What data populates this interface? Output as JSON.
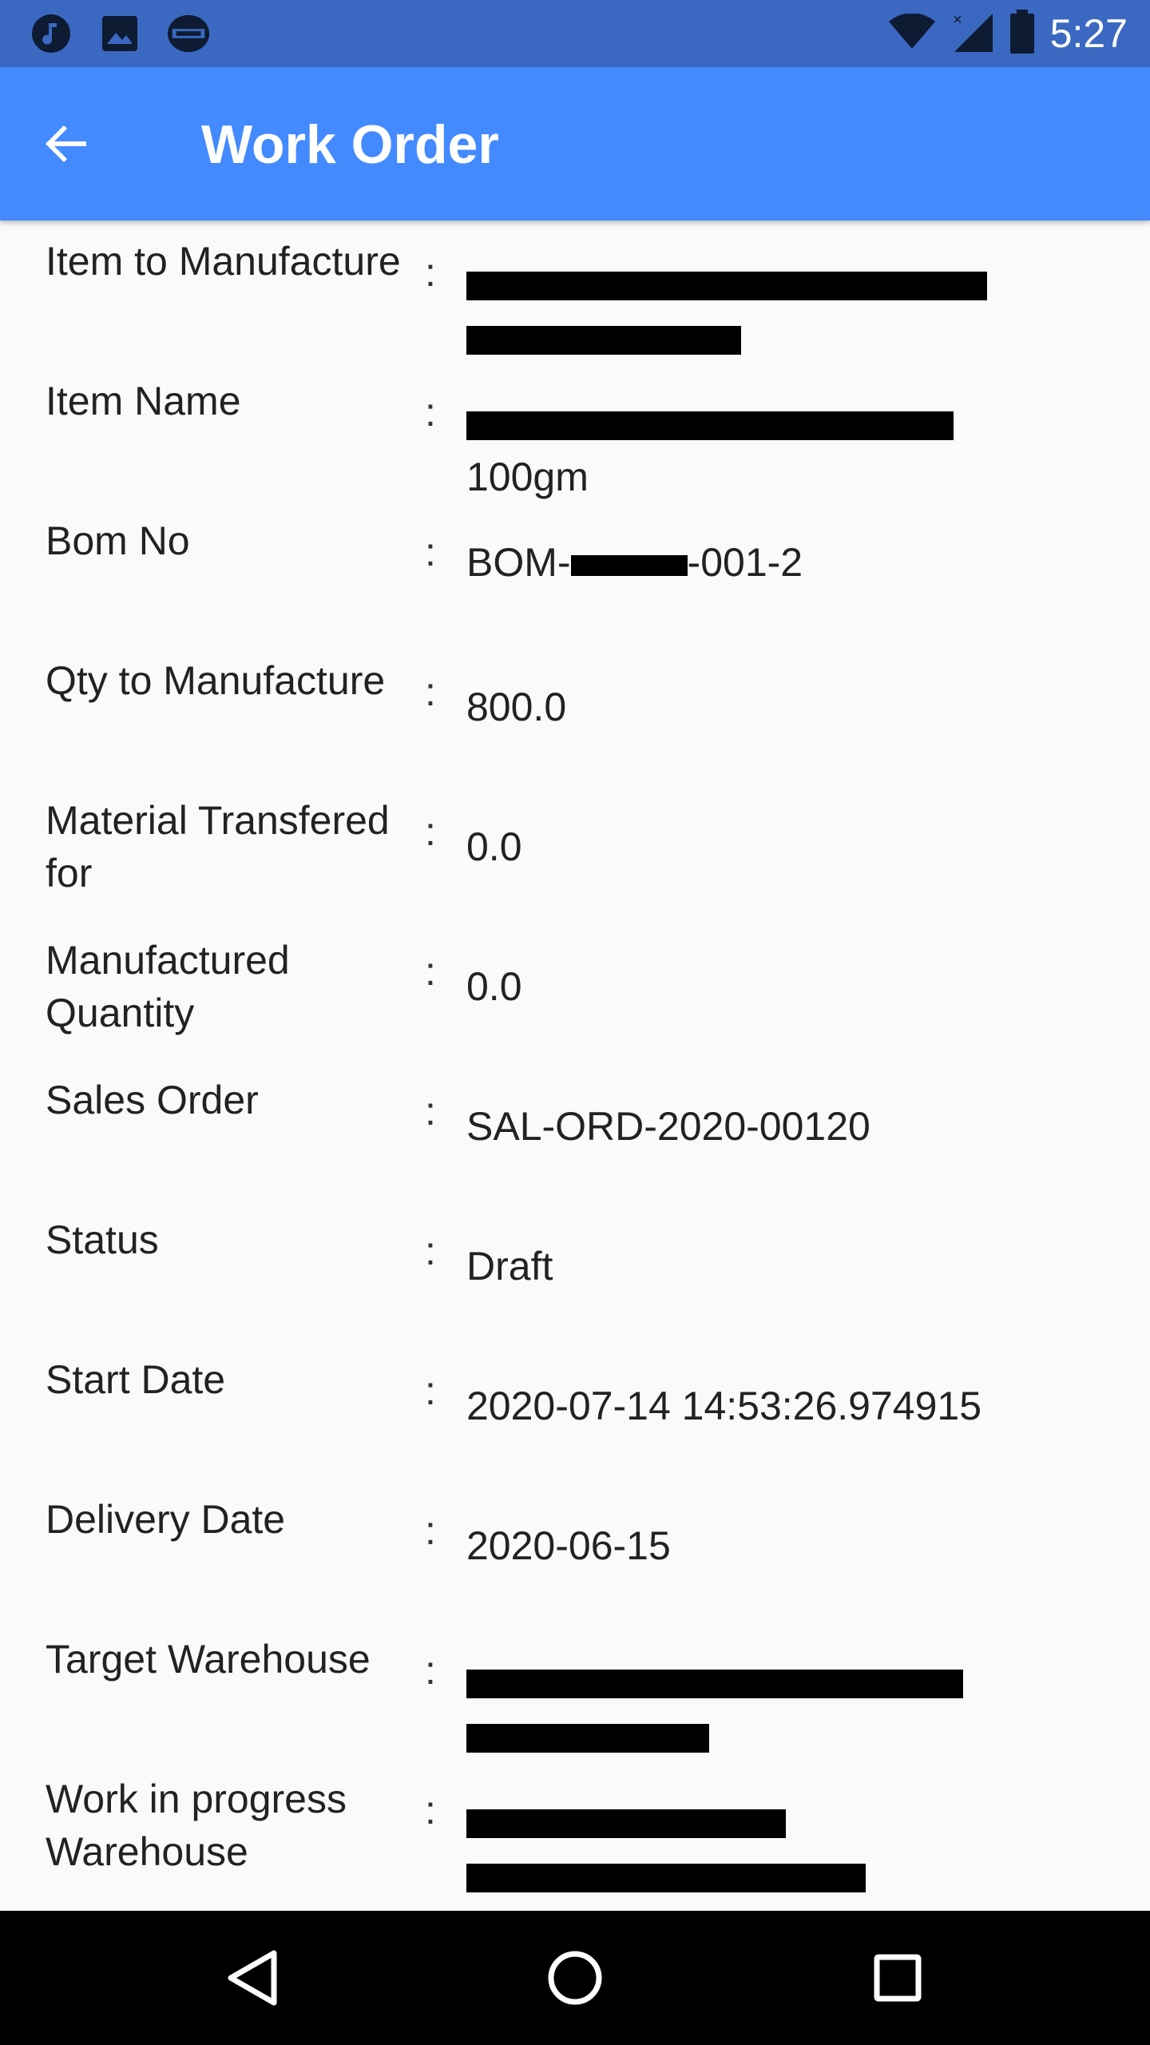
{
  "status_bar": {
    "time": "5:27",
    "left_icons": [
      "music-icon",
      "image-icon",
      "sync-icon"
    ],
    "right_icons": [
      "wifi-icon",
      "signal-icon",
      "battery-icon"
    ]
  },
  "app_bar": {
    "title": "Work Order",
    "color": "#448aff"
  },
  "fields": [
    {
      "label": "Item to Manufacture",
      "value": "",
      "redacted": true
    },
    {
      "label": "Item Name",
      "value": "100gm",
      "redacted": true
    },
    {
      "label": "Bom No",
      "value_prefix": "BOM-",
      "value_suffix": "-001-2",
      "redacted": true
    },
    {
      "label": "Qty to Manufacture",
      "value": "800.0"
    },
    {
      "label": "Material Transfered for",
      "value": "0.0"
    },
    {
      "label": "Manufactured Quantity",
      "value": "0.0"
    },
    {
      "label": "Sales Order",
      "value": "SAL-ORD-2020-00120"
    },
    {
      "label": "Status",
      "value": "Draft"
    },
    {
      "label": "Start Date",
      "value": "2020-07-14 14:53:26.974915"
    },
    {
      "label": "Delivery Date",
      "value": "2020-06-15"
    },
    {
      "label": "Target Warehouse",
      "value": "",
      "redacted": true
    },
    {
      "label": "Work in progress Warehouse",
      "value": "",
      "redacted": true
    }
  ],
  "colon": ":",
  "nav_bar": {
    "buttons": [
      "back-nav-icon",
      "home-nav-icon",
      "recents-nav-icon"
    ]
  }
}
